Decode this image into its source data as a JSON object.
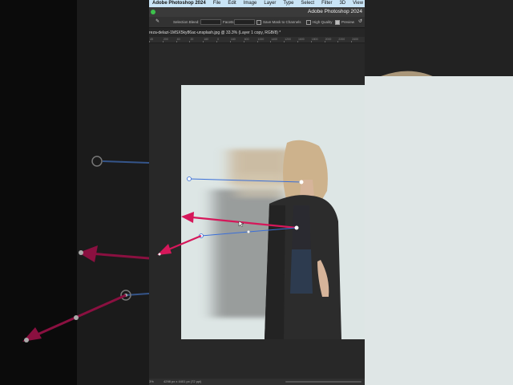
{
  "app": {
    "name": "Adobe Photoshop 2024",
    "menu": [
      "File",
      "Edit",
      "Image",
      "Layer",
      "Type",
      "Select",
      "Filter",
      "3D",
      "View"
    ],
    "window_title": "Adobe Photoshop 2024"
  },
  "options_bar": {
    "selection_blend_label": "Selection Bleed:",
    "facets_label": "Facets:",
    "save_mask_label": "Save Mask to Channels",
    "save_mask_checked": false,
    "high_quality_label": "High Quality",
    "high_quality_checked": false,
    "preview_label": "Preview",
    "preview_checked": true
  },
  "document": {
    "tab_title": "reza-delazi-1MSX5ky86ac-unsplash.jpg @ 33.3% (Layer 1 copy, RGB/8) *"
  },
  "ruler": {
    "ticks": [
      "45",
      "200",
      "40",
      "20",
      "160",
      "0",
      "160",
      "600",
      "1000",
      "1400",
      "1200",
      "1600",
      "1800",
      "2000",
      "2200",
      "2400"
    ]
  },
  "status_bar": {
    "zoom": "3%",
    "dimensions": "4298 px x 4401 px (72 ppi)"
  },
  "colors": {
    "arrow_pink": "#d6175a",
    "path_blue": "#3a6fd8",
    "menu_bg": "#c9e4f6",
    "canvas_bg": "#dde6e5"
  }
}
